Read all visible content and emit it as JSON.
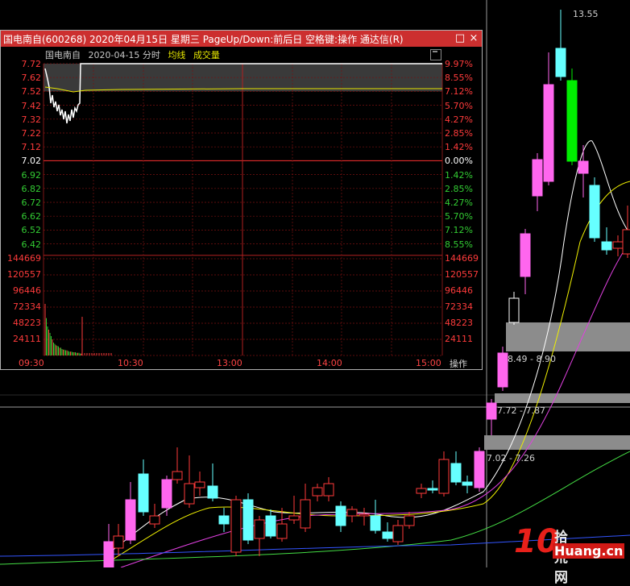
{
  "popup": {
    "title": "国电南自(600268) 2020年04月15日 星期三 PageUp/Down:前后日 空格键:操作 通达信(R)",
    "maximize_icon": "□",
    "close_icon": "×",
    "info": {
      "stock": "国电南自",
      "date": "2020-04-15 分时",
      "avg_label": "均线",
      "vol_label": "成交量"
    },
    "price_labels": [
      "7.72",
      "7.62",
      "7.52",
      "7.42",
      "7.32",
      "7.22",
      "7.12",
      "7.02",
      "6.92",
      "6.82",
      "6.72",
      "6.62",
      "6.52",
      "6.42"
    ],
    "pct_labels": [
      "9.97%",
      "8.55%",
      "7.12%",
      "5.70%",
      "4.27%",
      "2.85%",
      "1.42%",
      "0.00%",
      "1.42%",
      "2.85%",
      "4.27%",
      "5.70%",
      "7.12%",
      "8.55%"
    ],
    "vol_labels": [
      "144669",
      "120557",
      "96446",
      "72334",
      "48223",
      "24111"
    ],
    "time_labels": [
      "09:30",
      "10:30",
      "13:00",
      "14:00",
      "15:00"
    ],
    "op_button": "操作",
    "colors": {
      "up": "#ff3b3b",
      "down": "#33cc33",
      "flat": "#ffffff",
      "title_bg": "#cc2f2f",
      "avg_line": "#e6e600"
    }
  },
  "kline": {
    "peak_label": "13.55",
    "gaps": [
      {
        "label": "8.49 - 8.90"
      },
      {
        "label": "7.72 - 7.87"
      },
      {
        "label": "7.02 - 7.26"
      }
    ]
  },
  "watermark": {
    "number": "10",
    "cn": "拾荒网",
    "en": "Huang.cn"
  }
}
